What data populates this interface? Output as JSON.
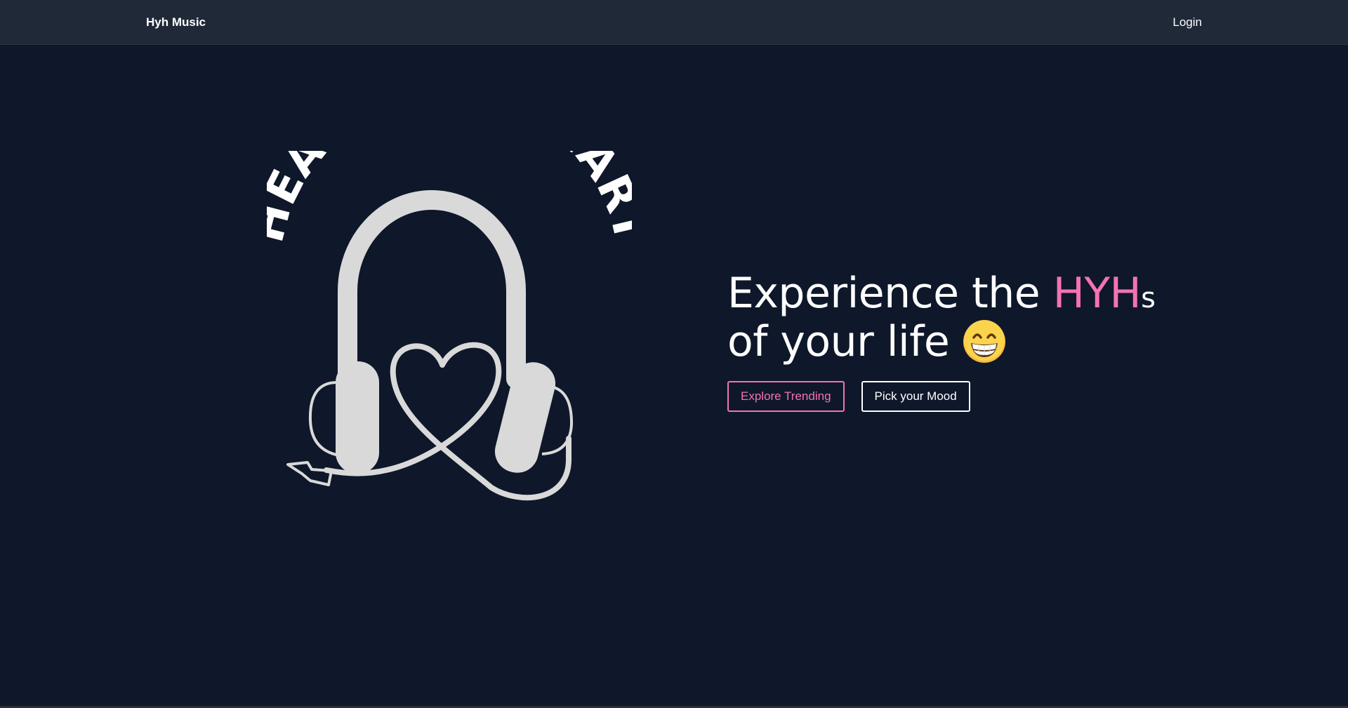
{
  "navbar": {
    "brand": "Hyh Music",
    "login_label": "Login"
  },
  "hero": {
    "logo_text": "HEAL YOUR HEART",
    "headline_part1": "Experience the ",
    "headline_accent": "HYH",
    "headline_suffix": "s",
    "headline_line2": "of your life",
    "emoji_icon": "grinning-face-icon"
  },
  "buttons": {
    "explore_label": "Explore Trending",
    "mood_label": "Pick your Mood"
  },
  "colors": {
    "background": "#0f172a",
    "navbar": "#1f2937",
    "accent": "#f472b6",
    "logo_gray": "#d9d9d9"
  }
}
